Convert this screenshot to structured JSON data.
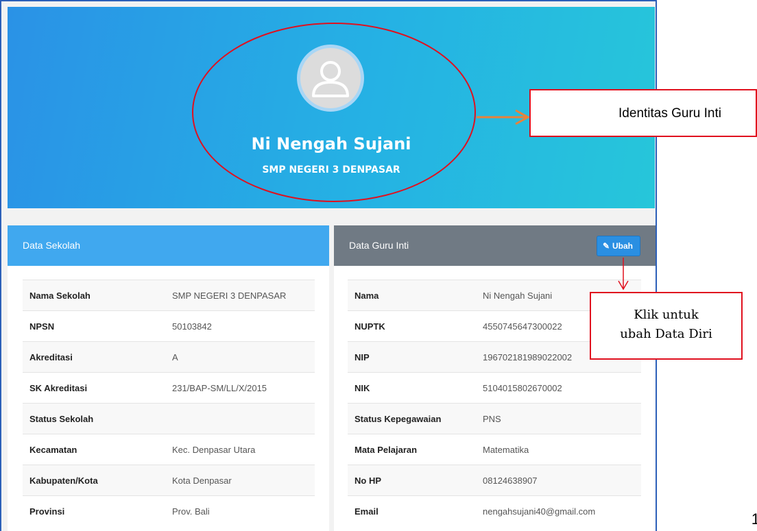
{
  "profile": {
    "name": "Ni Nengah Sujani",
    "school": "SMP NEGERI 3 DENPASAR",
    "avatar_icon": "user-silhouette-icon"
  },
  "school_panel": {
    "title": "Data Sekolah",
    "rows": [
      {
        "label": "Nama Sekolah",
        "value": "SMP NEGERI 3 DENPASAR"
      },
      {
        "label": "NPSN",
        "value": "50103842"
      },
      {
        "label": "Akreditasi",
        "value": "A"
      },
      {
        "label": "SK Akreditasi",
        "value": "231/BAP-SM/LL/X/2015"
      },
      {
        "label": "Status Sekolah",
        "value": ""
      },
      {
        "label": "Kecamatan",
        "value": "Kec. Denpasar Utara"
      },
      {
        "label": "Kabupaten/Kota",
        "value": "Kota Denpasar"
      },
      {
        "label": "Provinsi",
        "value": "Prov. Bali"
      }
    ]
  },
  "teacher_panel": {
    "title": "Data Guru Inti",
    "edit_label": "Ubah",
    "edit_icon": "pencil-icon",
    "rows": [
      {
        "label": "Nama",
        "value": "Ni Nengah Sujani"
      },
      {
        "label": "NUPTK",
        "value": "4550745647300022"
      },
      {
        "label": "NIP",
        "value": "196702181989022002"
      },
      {
        "label": "NIK",
        "value": "5104015802670002"
      },
      {
        "label": "Status Kepegawaian",
        "value": "PNS"
      },
      {
        "label": "Mata Pelajaran",
        "value": "Matematika"
      },
      {
        "label": "No HP",
        "value": "08124638907"
      },
      {
        "label": "Email",
        "value": "nengahsujani40@gmail.com"
      }
    ]
  },
  "annotations": {
    "identity_callout": "Identitas Guru Inti",
    "edit_callout_line1": "Klik untuk",
    "edit_callout_line2": "ubah Data Diri",
    "colors": {
      "circle": "#e0101e",
      "arrow_orange": "#e8823a",
      "arrow_red": "#e0101e"
    }
  },
  "page_number": "1"
}
